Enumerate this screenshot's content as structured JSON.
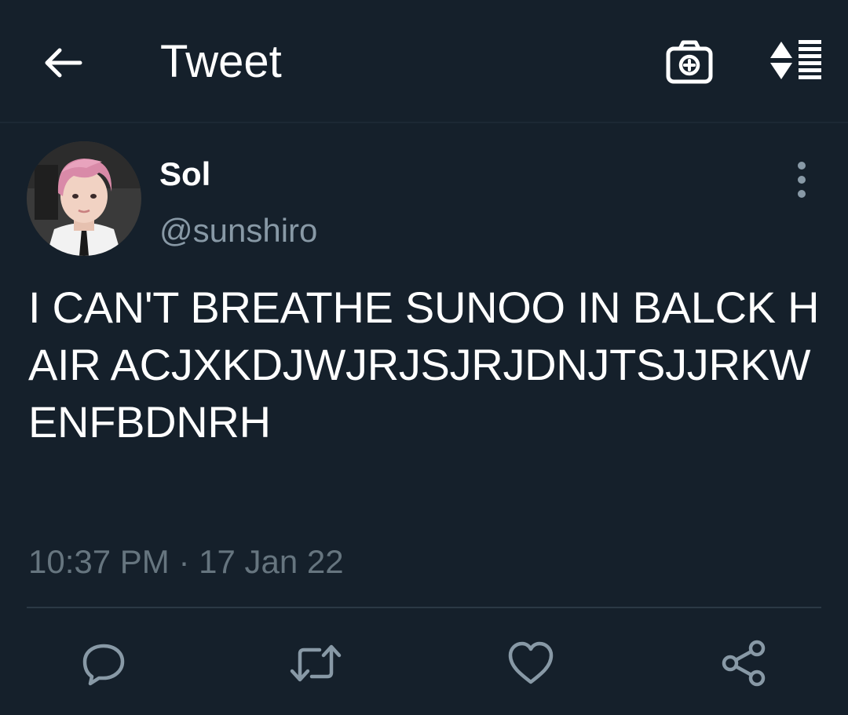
{
  "header": {
    "title": "Tweet",
    "back_icon": "arrow-left-icon",
    "camera_icon": "camera-plus-icon",
    "sort_icon": "sort-thread-icon"
  },
  "tweet": {
    "author": {
      "name": "Sol",
      "handle": "@sunshiro",
      "avatar": "avatar-photo-pink-hair"
    },
    "text": "I CAN'T  BREATHE SUNOO IN BALCK HAIR ACJXKDJWJRJSJRJDNJTSJJRKWENFBDNRH",
    "timestamp": "10:37 PM · 17 Jan 22"
  },
  "actions": {
    "reply_icon": "comment-icon",
    "retweet_icon": "retweet-icon",
    "like_icon": "heart-icon",
    "share_icon": "share-icon"
  },
  "colors": {
    "background": "#15202b",
    "secondary_text": "#8899a6",
    "icon": "#8899a6"
  }
}
